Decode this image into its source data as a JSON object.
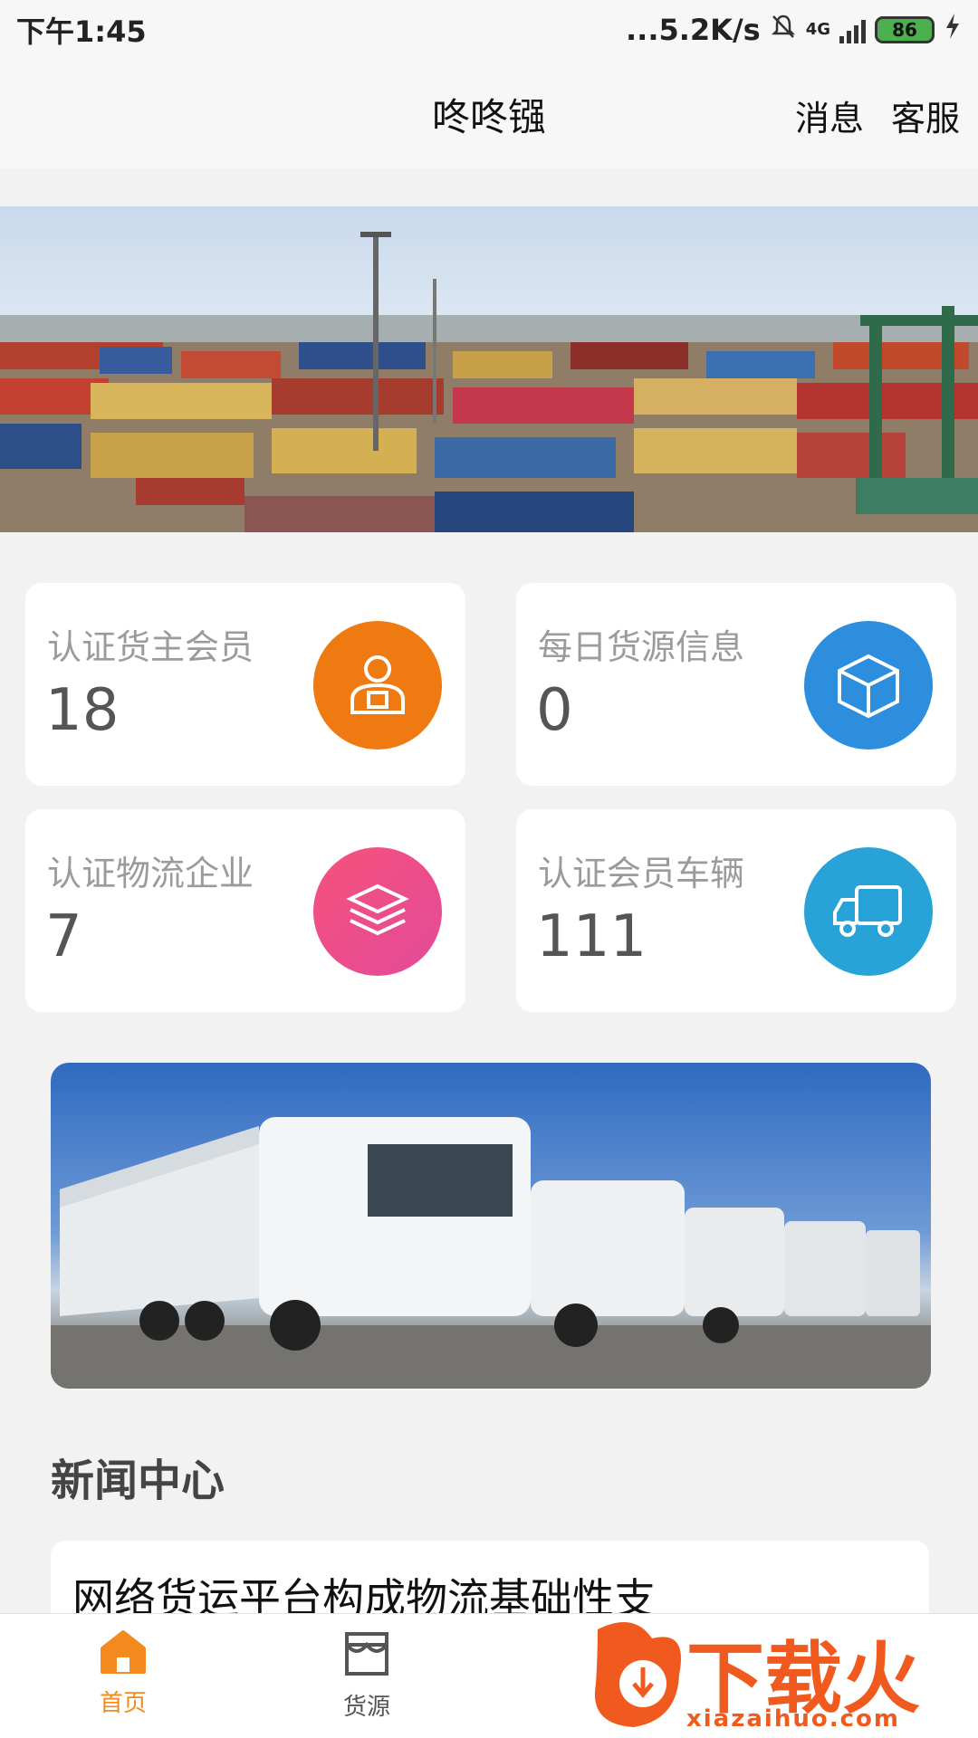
{
  "status_bar": {
    "time": "下午1:45",
    "net_speed": "...5.2K/s",
    "network": "4G",
    "battery": "86"
  },
  "nav": {
    "title": "咚咚镪",
    "messages": "消息",
    "service": "客服"
  },
  "stats": [
    {
      "label": "认证货主会员",
      "value": "18",
      "icon": "user-package-icon",
      "color": "#f07a12"
    },
    {
      "label": "每日货源信息",
      "value": "0",
      "icon": "box-icon",
      "color": "#2d8ede"
    },
    {
      "label": "认证物流企业",
      "value": "7",
      "icon": "layers-icon",
      "color": "#ef4d82"
    },
    {
      "label": "认证会员车辆",
      "value": "111",
      "icon": "truck-icon",
      "color": "#27a3d8"
    }
  ],
  "news": {
    "section_title": "新闻中心",
    "items": [
      {
        "title": "网络货运平台构成物流基础性支"
      }
    ]
  },
  "tabs": [
    {
      "label": "首页",
      "icon": "home-icon",
      "active": true,
      "color": "#f28a1e"
    },
    {
      "label": "货源",
      "icon": "store-icon",
      "active": false,
      "color": "#555555"
    }
  ],
  "watermark": {
    "text": "下载火",
    "url": "xiazaihuo.com"
  }
}
